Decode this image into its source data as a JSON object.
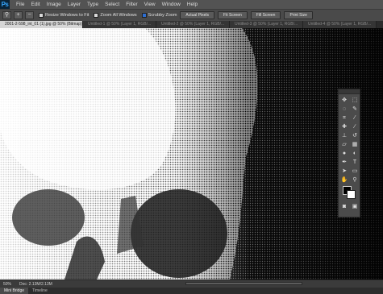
{
  "app": {
    "logo": "Ps"
  },
  "menu": [
    "File",
    "Edit",
    "Image",
    "Layer",
    "Type",
    "Select",
    "Filter",
    "View",
    "Window",
    "Help"
  ],
  "options": {
    "icons": [
      "hand-icon",
      "zoom-in-icon",
      "zoom-out-icon"
    ],
    "checkboxes": [
      "Resize Windows to Fit",
      "Zoom All Windows",
      "Scrubby Zoom"
    ],
    "buttons": [
      "Actual Pixels",
      "Fit Screen",
      "Fill Screen",
      "Print Size"
    ]
  },
  "tabs": [
    {
      "label": "2001-2-598_int_01 (1).jpg @ 50% (Bitmap)",
      "active": true
    },
    {
      "label": "Untitled-1 @ 50% (Layer 1, RGB/...",
      "active": false
    },
    {
      "label": "Untitled-2 @ 50% (Layer 1, RGB/...",
      "active": false
    },
    {
      "label": "Untitled-3 @ 50% (Layer 1, RGB/...",
      "active": false
    },
    {
      "label": "Untitled-4 @ 50% (Layer 1, RGB/...",
      "active": false
    }
  ],
  "toolbox": {
    "tools": [
      "move-icon",
      "marquee-icon",
      "lasso-icon",
      "quick-select-icon",
      "crop-icon",
      "eyedropper-icon",
      "healing-brush-icon",
      "brush-icon",
      "clone-stamp-icon",
      "history-brush-icon",
      "eraser-icon",
      "gradient-icon",
      "blur-icon",
      "dodge-icon",
      "pen-icon",
      "type-icon",
      "path-select-icon",
      "shape-icon",
      "hand-icon",
      "zoom-icon"
    ],
    "colors": {
      "foreground": "#000000",
      "background": "#ffffff"
    }
  },
  "status": {
    "zoom": "50%",
    "doc": "Doc: 2.13M/2.13M"
  },
  "panel_tabs": [
    "Mini Bridge",
    "Timeline"
  ]
}
